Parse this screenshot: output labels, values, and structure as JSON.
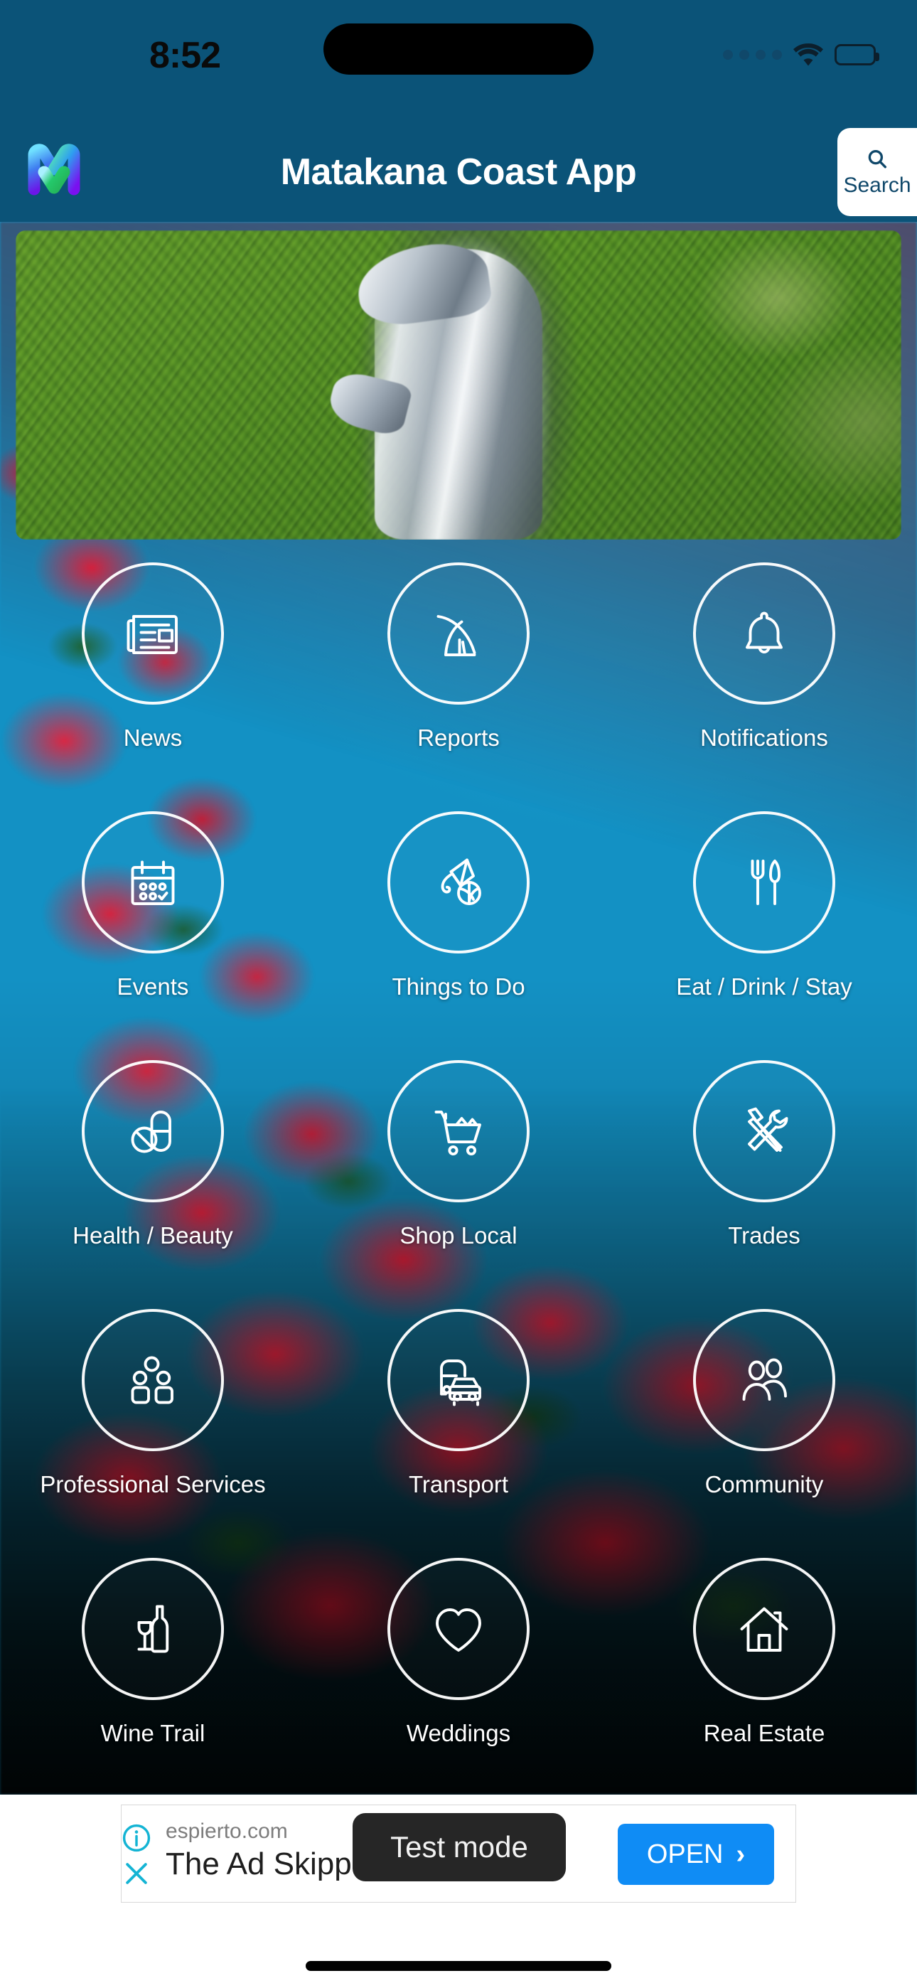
{
  "status_bar": {
    "time": "8:52",
    "cellular_icon": "cellular-dots-icon",
    "wifi_icon": "wifi-icon",
    "battery_icon": "battery-full-icon"
  },
  "header": {
    "logo_icon": "matakana-m-logo-icon",
    "title": "Matakana Coast App",
    "search_icon": "search-icon",
    "search_label": "Search"
  },
  "hero": {
    "alt": "Chrome dinosaur sculpture in a green garden hedge"
  },
  "grid": {
    "tiles": [
      {
        "label": "News",
        "icon": "newspaper-icon"
      },
      {
        "label": "Reports",
        "icon": "road-icon"
      },
      {
        "label": "Notifications",
        "icon": "bell-icon"
      },
      {
        "label": "Events",
        "icon": "calendar-check-icon"
      },
      {
        "label": "Things to Do",
        "icon": "kite-ball-icon"
      },
      {
        "label": "Eat / Drink / Stay",
        "icon": "fork-knife-icon"
      },
      {
        "label": "Health / Beauty",
        "icon": "pills-icon"
      },
      {
        "label": "Shop Local",
        "icon": "shopping-cart-icon"
      },
      {
        "label": "Trades",
        "icon": "hammer-wrench-icon"
      },
      {
        "label": "Professional Services",
        "icon": "people-group-icon"
      },
      {
        "label": "Transport",
        "icon": "car-bus-icon"
      },
      {
        "label": "Community",
        "icon": "two-people-icon"
      },
      {
        "label": "Wine Trail",
        "icon": "wine-bottle-glass-icon"
      },
      {
        "label": "Weddings",
        "icon": "heart-icon"
      },
      {
        "label": "Real Estate",
        "icon": "house-icon"
      }
    ]
  },
  "ad": {
    "info_icon": "info-circle-icon",
    "close_icon": "close-x-icon",
    "domain": "espierto.com",
    "headline": "The Ad Skipper",
    "open_label": "OPEN",
    "open_chevron": "›"
  },
  "overlay": {
    "test_mode_label": "Test mode"
  },
  "colors": {
    "header_blue": "#0b5378",
    "sky_blue": "#1196c9",
    "ad_accent_blue": "#0f8cf5",
    "ad_icon_cyan": "#14b4d4",
    "white": "#ffffff"
  }
}
